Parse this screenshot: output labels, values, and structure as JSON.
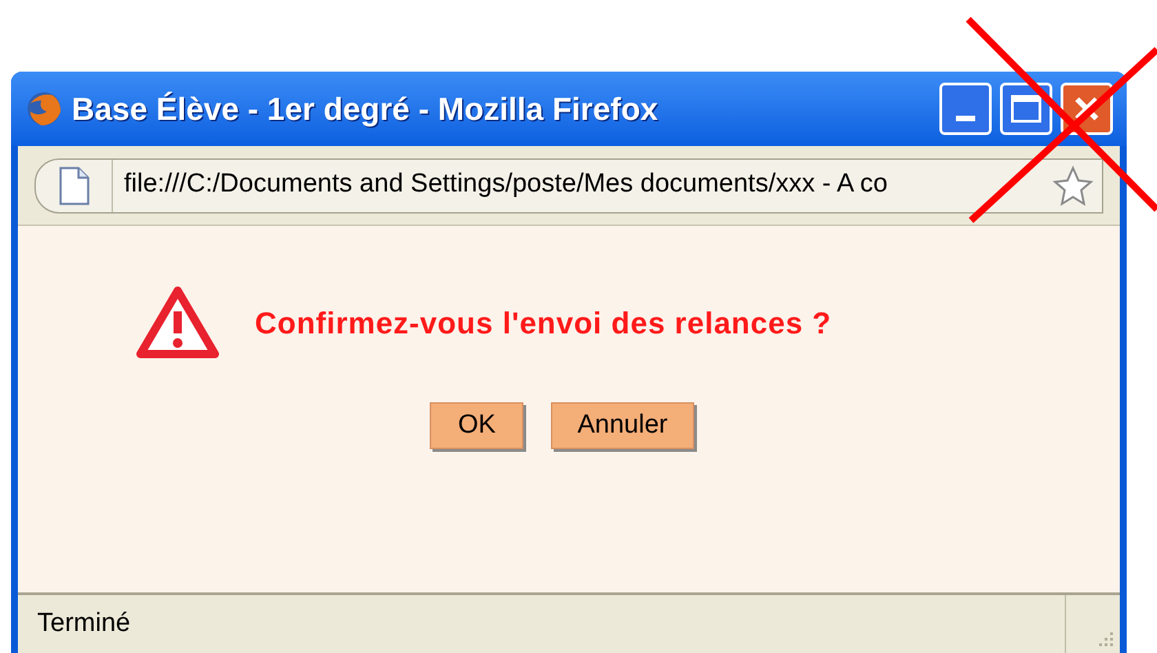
{
  "window": {
    "title": "Base Élève - 1er degré - Mozilla Firefox"
  },
  "address_bar": {
    "value": "file:///C:/Documents and Settings/poste/Mes documents/xxx - A co"
  },
  "dialog": {
    "message": "Confirmez-vous l'envoi des relances ?",
    "buttons": [
      "OK",
      "Annuler"
    ]
  },
  "status_bar": {
    "text": "Terminé"
  }
}
